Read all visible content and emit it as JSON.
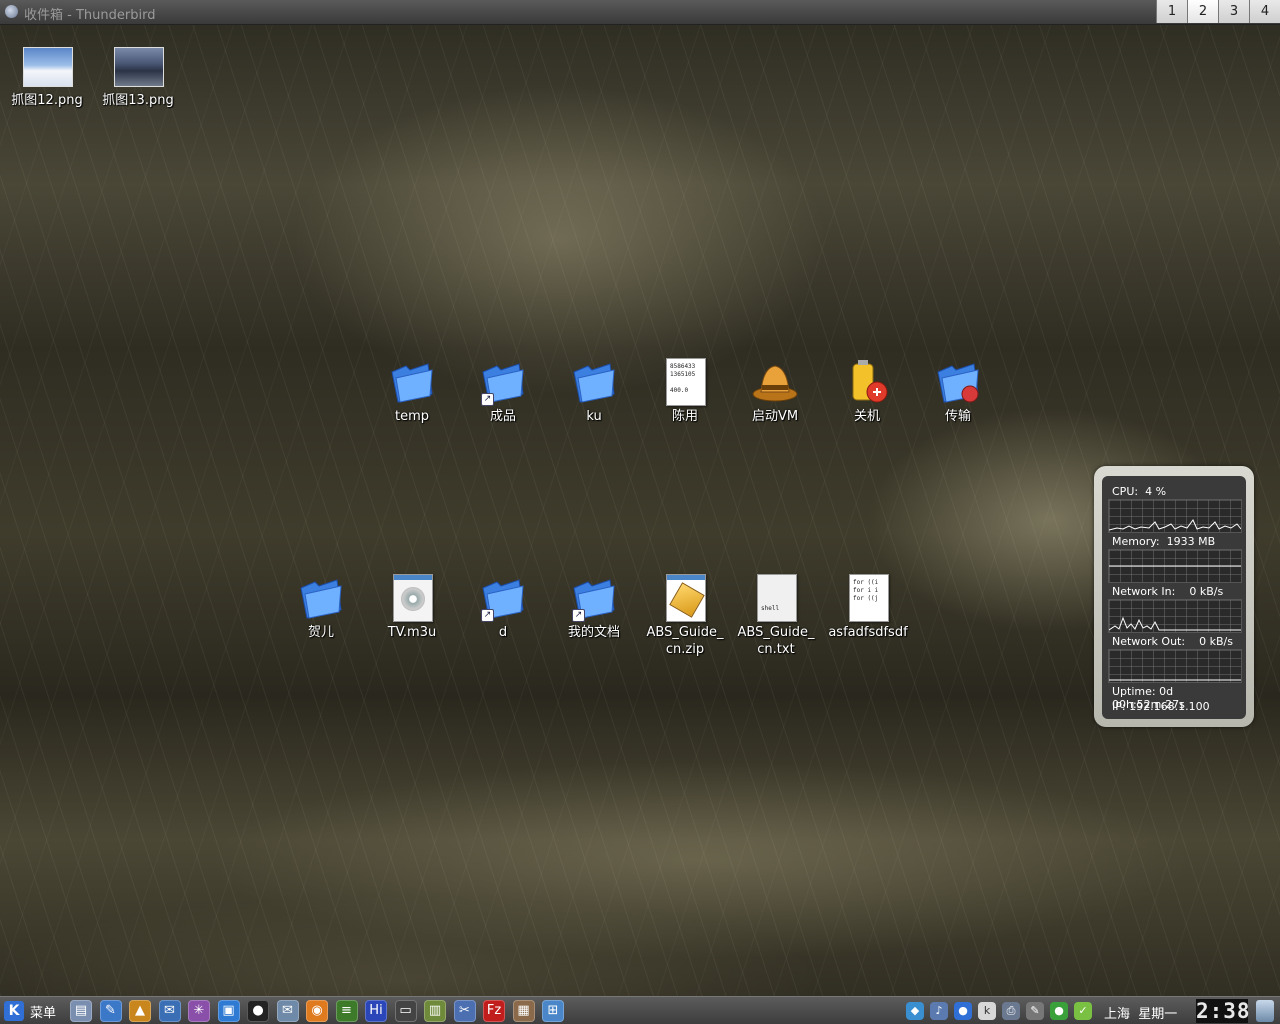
{
  "window": {
    "title": "收件箱 - Thunderbird",
    "pager": [
      "1",
      "2",
      "3",
      "4"
    ],
    "active_desktop": 2
  },
  "desktop": {
    "icons": [
      {
        "label": "抓图12.png",
        "type": "image",
        "icon": "snow-landscape-image"
      },
      {
        "label": "抓图13.png",
        "type": "image",
        "icon": "city-image"
      },
      {
        "label": "temp",
        "type": "folder",
        "icon": "folder-icon"
      },
      {
        "label": "成品",
        "type": "folder-link",
        "icon": "folder-icon"
      },
      {
        "label": "ku",
        "type": "folder",
        "icon": "folder-icon"
      },
      {
        "label": "陈用",
        "type": "document",
        "icon": "text-document-icon",
        "preview": "8586433\n1365105\n\n400.0"
      },
      {
        "label": "启动VM",
        "type": "app",
        "icon": "vmware-hat-icon"
      },
      {
        "label": "关机",
        "type": "app",
        "icon": "power-battery-icon"
      },
      {
        "label": "传输",
        "type": "app",
        "icon": "folder-transfer-icon"
      },
      {
        "label": "贺儿",
        "type": "folder",
        "icon": "folder-icon"
      },
      {
        "label": "TV.m3u",
        "type": "playlist",
        "icon": "media-playlist-icon"
      },
      {
        "label": "d",
        "type": "folder-link",
        "icon": "folder-icon"
      },
      {
        "label": "我的文档",
        "type": "folder-link",
        "icon": "folder-icon"
      },
      {
        "label": "ABS_Guide_\ncn.zip",
        "type": "archive",
        "icon": "zip-archive-icon"
      },
      {
        "label": "ABS_Guide_\ncn.txt",
        "type": "shell-script",
        "icon": "shell-script-icon",
        "preview": "shell"
      },
      {
        "label": "asfadfsdfsdf",
        "type": "text",
        "icon": "text-document-icon",
        "preview": "for ((i\nfor i i\nfor ((j"
      }
    ]
  },
  "sysmon": {
    "cpu_label": "CPU:",
    "cpu_value": "4 %",
    "memory_label": "Memory:",
    "memory_value": "1933 MB",
    "net_in_label": "Network In:",
    "net_in_value": "0 kB/s",
    "net_out_label": "Network Out:",
    "net_out_value": "0 kB/s",
    "uptime_label": "Uptime:",
    "uptime_value": "0d 00h:52m:27s",
    "ip_label": "IP:",
    "ip_value": "192.168.1.100"
  },
  "taskbar": {
    "menu_label": "菜单",
    "launchers": [
      {
        "name": "file-manager-icon",
        "color": "#7a8fb0",
        "glyph": "▤"
      },
      {
        "name": "editor-icon",
        "color": "#3c78c8",
        "glyph": "✎"
      },
      {
        "name": "vmware-hat-icon",
        "color": "#c9861c",
        "glyph": "▲"
      },
      {
        "name": "thunderbird-icon",
        "color": "#3b6fb5",
        "glyph": "✉"
      },
      {
        "name": "network-tool-icon",
        "color": "#8a4fa8",
        "glyph": "✳"
      },
      {
        "name": "terminal-screen-icon",
        "color": "#2f7bd3",
        "glyph": "▣"
      },
      {
        "name": "qq-penguin-icon",
        "color": "#222222",
        "glyph": "●"
      },
      {
        "name": "mail-client-icon",
        "color": "#6f8aa8",
        "glyph": "✉"
      },
      {
        "name": "firefox-icon",
        "color": "#e07a1f",
        "glyph": "◉"
      },
      {
        "name": "stripes-app-icon",
        "color": "#3d7a2a",
        "glyph": "≡"
      },
      {
        "name": "hi-messenger-icon",
        "color": "#2b46b8",
        "glyph": "Hi"
      },
      {
        "name": "monitor-icon",
        "color": "#444444",
        "glyph": "▭"
      },
      {
        "name": "books-icon",
        "color": "#6f8a3a",
        "glyph": "▥"
      },
      {
        "name": "tools-icon",
        "color": "#4b6fb0",
        "glyph": "✂"
      },
      {
        "name": "filezilla-icon",
        "color": "#c21d1d",
        "glyph": "Fz"
      },
      {
        "name": "package-icon",
        "color": "#8a6a4a",
        "glyph": "▦"
      },
      {
        "name": "network-map-icon",
        "color": "#4a86c8",
        "glyph": "⊞"
      }
    ],
    "tray": [
      {
        "name": "cube-status-icon",
        "color": "#3a8fd0",
        "glyph": "◆"
      },
      {
        "name": "volume-icon",
        "color": "#5b7ab0",
        "glyph": "♪"
      },
      {
        "name": "bluetooth-blob-icon",
        "color": "#2f6fd6",
        "glyph": "●"
      },
      {
        "name": "kde-k-icon",
        "color": "#d7d7d7",
        "glyph": "k"
      },
      {
        "name": "printer-icon",
        "color": "#6a7890",
        "glyph": "⎙"
      },
      {
        "name": "pen-icon",
        "color": "#777777",
        "glyph": "✎"
      },
      {
        "name": "green-status-icon",
        "color": "#3aa03a",
        "glyph": "●"
      },
      {
        "name": "check-icon",
        "color": "#7ac143",
        "glyph": "✓"
      }
    ],
    "location": "上海",
    "weekday": "星期一",
    "clock": "2:38"
  }
}
